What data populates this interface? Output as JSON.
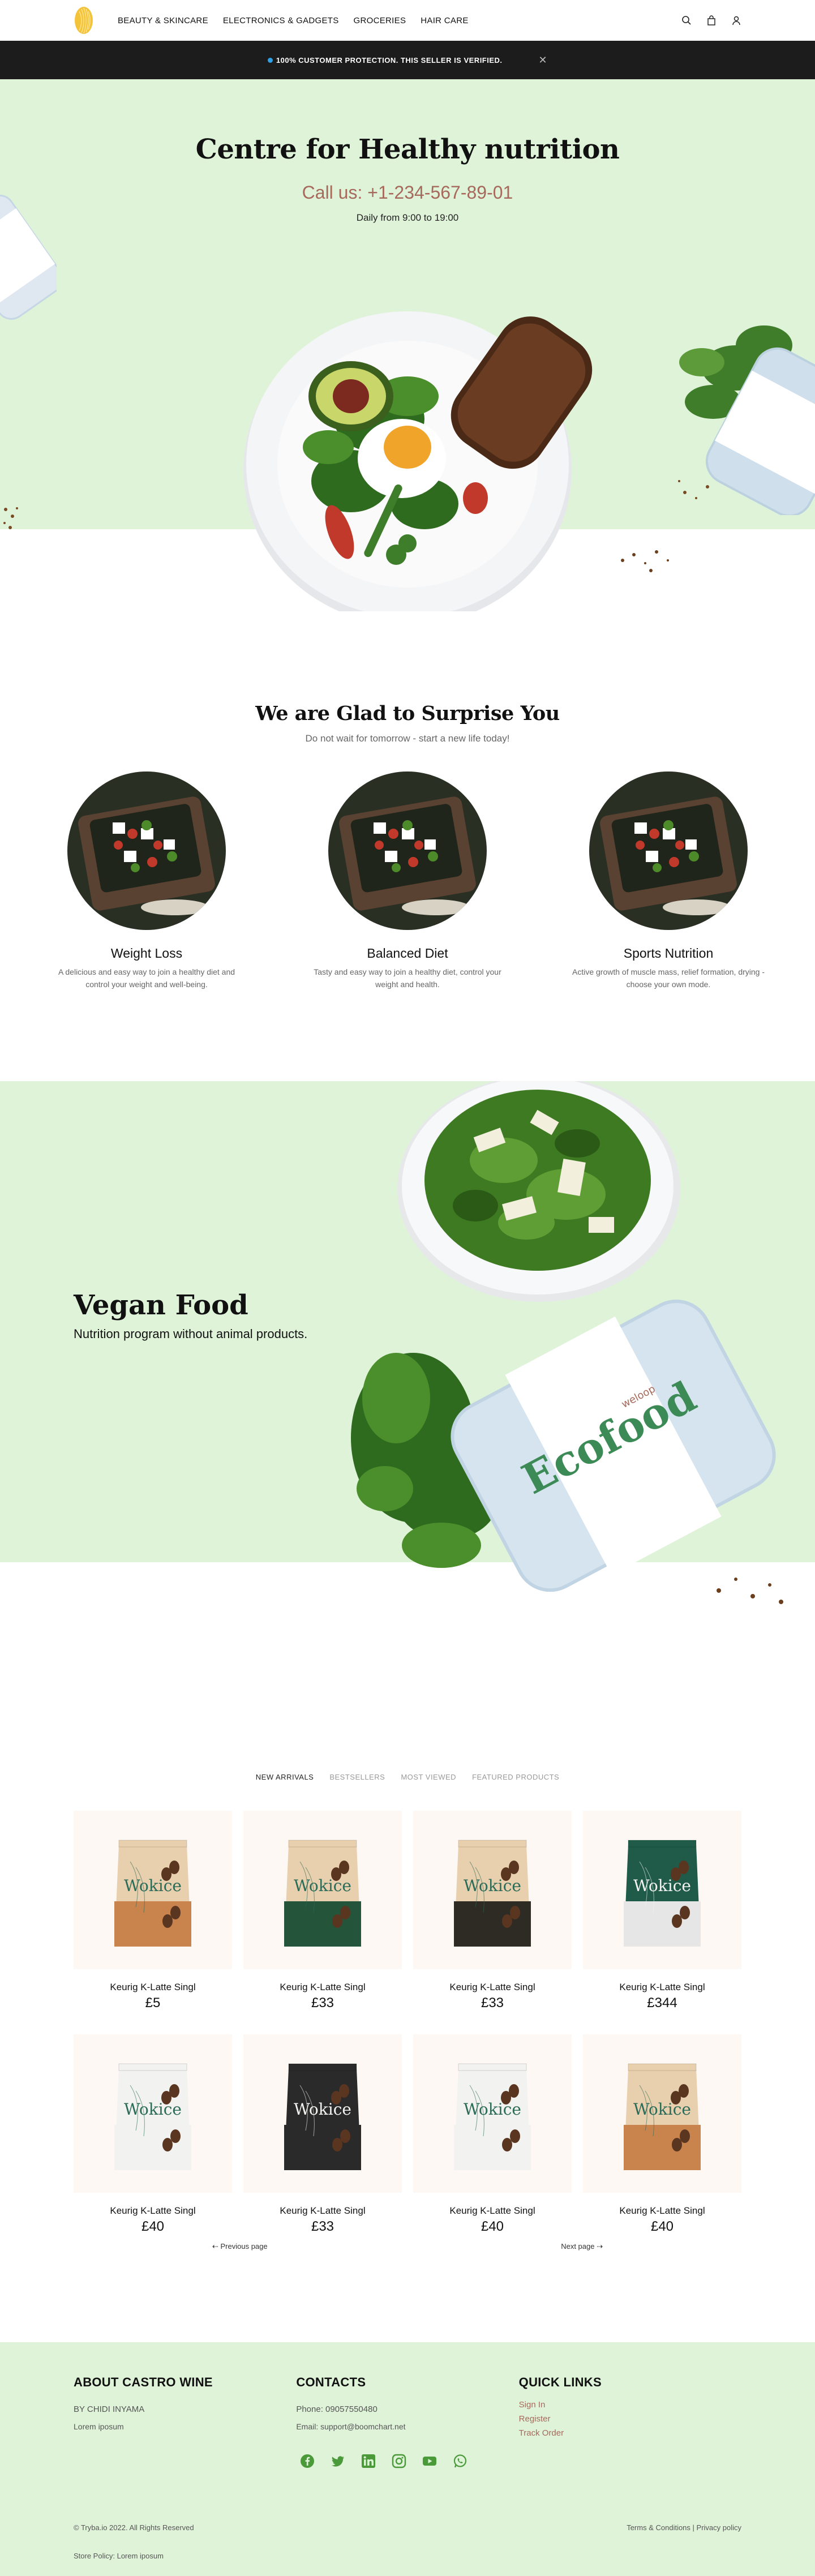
{
  "nav": {
    "items": [
      "BEAUTY & SKINCARE",
      "ELECTRONICS & GADGETS",
      "GROCERIES",
      "HAIR CARE"
    ]
  },
  "notice": {
    "text": "100% CUSTOMER PROTECTION. THIS SELLER IS VERIFIED.",
    "close": "✕"
  },
  "hero": {
    "title": "Centre for Healthy nutrition",
    "call": "Call us: +1-234-567-89-01",
    "hours": "Daily from 9:00 to 19:00"
  },
  "surprise": {
    "title": "We are Glad to Surprise You",
    "subtitle": "Do not wait for tomorrow - start a new life today!",
    "cards": [
      {
        "title": "Weight Loss",
        "text": "A delicious and easy way to join a healthy diet and control your weight and well-being."
      },
      {
        "title": "Balanced Diet",
        "text": "Tasty and easy way to join a healthy diet, control your weight and health."
      },
      {
        "title": "Sports Nutrition",
        "text": "Active growth of muscle mass, relief formation, drying - choose your own mode."
      }
    ]
  },
  "vegan": {
    "title": "Vegan Food",
    "subtitle": "Nutrition program without animal products.",
    "box_brand": "Ecofood",
    "box_sub": "weloop"
  },
  "products": {
    "tabs": [
      "NEW ARRIVALS",
      "BESTSELLERS",
      "MOST VIEWED",
      "FEATURED PRODUCTS"
    ],
    "bag_brand": "Wokice",
    "items": [
      {
        "name": "Keurig K-Latte Singl",
        "price": "£5"
      },
      {
        "name": "Keurig K-Latte Singl",
        "price": "£33"
      },
      {
        "name": "Keurig K-Latte Singl",
        "price": "£33"
      },
      {
        "name": "Keurig K-Latte Singl",
        "price": "£344"
      },
      {
        "name": "Keurig K-Latte Singl",
        "price": "£40"
      },
      {
        "name": "Keurig K-Latte Singl",
        "price": "£33"
      },
      {
        "name": "Keurig K-Latte Singl",
        "price": "£40"
      },
      {
        "name": "Keurig K-Latte Singl",
        "price": "£40"
      }
    ],
    "prev": "Previous page",
    "next": "Next page"
  },
  "footer": {
    "about_title": "ABOUT CASTRO WINE",
    "about_by": "BY CHIDI INYAMA",
    "about_text": "Lorem iposum",
    "contacts_title": "CONTACTS",
    "phone": "Phone: 09057550480",
    "email": "Email: support@boomchart.net",
    "links_title": "QUICK LINKS",
    "links": [
      "Sign In",
      "Register",
      "Track Order"
    ],
    "copyright": "© Tryba.io 2022. All Rights Reserved",
    "terms": "Terms & Conditions",
    "privacy": "Privacy policy",
    "store_policy": "Store Policy: Lorem iposum"
  },
  "colors": {
    "green": "#dff3d9",
    "accent": "#a6695b",
    "dark": "#1c1c1c",
    "verified_dot": "#2ea0e6"
  },
  "icons": [
    "brand-logo-icon",
    "search-icon",
    "bag-icon",
    "user-icon",
    "close-icon",
    "facebook-icon",
    "twitter-icon",
    "linkedin-icon",
    "instagram-icon",
    "youtube-icon",
    "whatsapp-icon"
  ]
}
